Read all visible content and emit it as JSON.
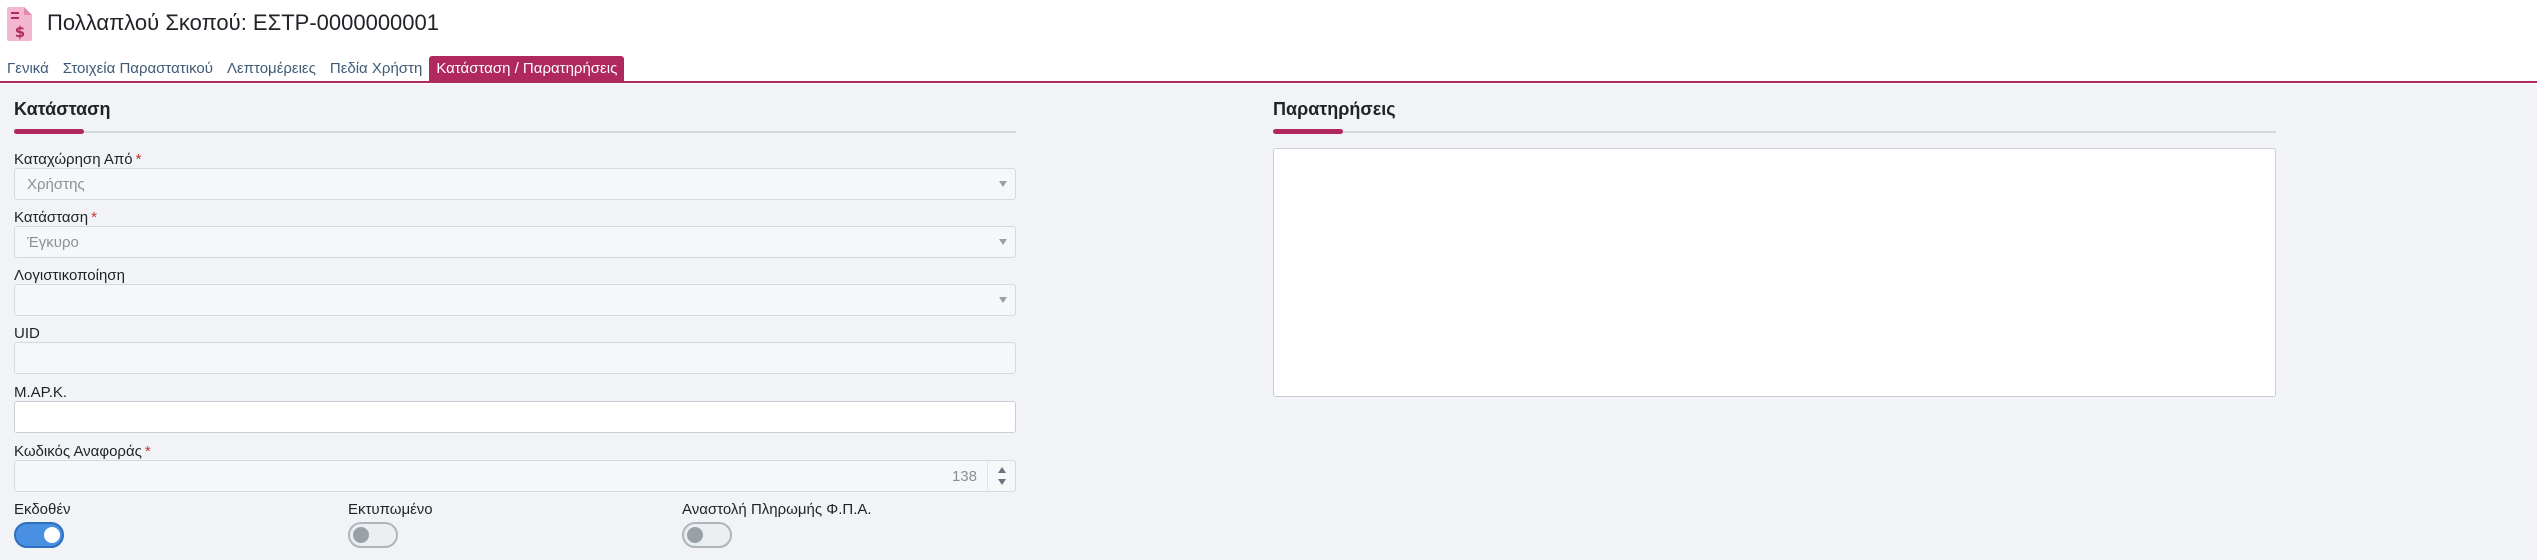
{
  "header": {
    "title": "Πολλαπλού Σκοπού: ΕΣΤΡ-0000000001",
    "icon": "invoice-dollar-icon",
    "accent_color": "#b0295e"
  },
  "tabs": [
    {
      "label": "Γενικά",
      "active": false
    },
    {
      "label": "Στοιχεία Παραστατικού",
      "active": false
    },
    {
      "label": "Λεπτομέρειες",
      "active": false
    },
    {
      "label": "Πεδία Χρήστη",
      "active": false
    },
    {
      "label": "Κατάσταση / Παρατηρήσεις",
      "active": true
    }
  ],
  "status_section": {
    "title": "Κατάσταση",
    "registered_by": {
      "label": "Καταχώρηση Από",
      "required": "*",
      "value": "Χρήστης"
    },
    "status": {
      "label": "Κατάσταση",
      "required": "*",
      "value": "Έγκυρο"
    },
    "accounting": {
      "label": "Λογιστικοποίηση",
      "value": ""
    },
    "uid": {
      "label": "UID",
      "value": ""
    },
    "mark": {
      "label": "Μ.ΑΡ.Κ.",
      "value": ""
    },
    "reference_code": {
      "label": "Κωδικός Αναφοράς",
      "required": "*",
      "value": "138"
    },
    "issued": {
      "label": "Εκδοθέν",
      "on": true
    },
    "printed": {
      "label": "Εκτυπωμένο",
      "on": false
    },
    "vat_suspension": {
      "label": "Αναστολή Πληρωμής Φ.Π.Α.",
      "on": false
    }
  },
  "notes_section": {
    "title": "Παρατηρήσεις",
    "value": ""
  }
}
